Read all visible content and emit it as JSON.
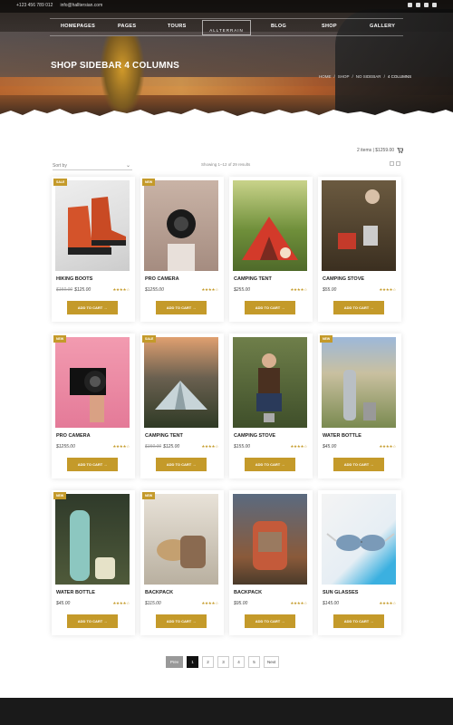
{
  "topbar": {
    "phone": "+123 456 789 012",
    "email": "info@halltersian.com"
  },
  "nav": {
    "items": [
      "HOMEPAGES",
      "PAGES",
      "TOURS",
      "BLOG",
      "SHOP",
      "GALLERY"
    ],
    "logo": "ALLTERRAIN"
  },
  "hero": {
    "title": "SHOP SIDEBAR 4 COLUMNS",
    "breadcrumb": [
      "HOME",
      "/",
      "SHOP",
      "/",
      "NO SIDEBAR",
      "/",
      "4 COLUMNS"
    ]
  },
  "toolbar": {
    "cart": "2 items | $1259.00",
    "sort": "Sort by",
    "results": "Showing 1–12 of 29 results"
  },
  "products": [
    {
      "badge": "SALE",
      "title": "HIKING BOOTS",
      "old_price": "$150.00",
      "price": "$125.00",
      "stars": "★★★★☆",
      "button": "ADD TO CART →"
    },
    {
      "badge": "NEW",
      "title": "PRO CAMERA",
      "old_price": "",
      "price": "$1255.00",
      "stars": "★★★★☆",
      "button": "ADD TO CART →"
    },
    {
      "badge": "",
      "title": "CAMPING TENT",
      "old_price": "",
      "price": "$255.00",
      "stars": "★★★★☆",
      "button": "ADD TO CART →"
    },
    {
      "badge": "",
      "title": "CAMPING STOVE",
      "old_price": "",
      "price": "$55.00",
      "stars": "★★★★☆",
      "button": "ADD TO CART →"
    },
    {
      "badge": "NEW",
      "title": "PRO CAMERA",
      "old_price": "",
      "price": "$1255.00",
      "stars": "★★★★☆",
      "button": "ADD TO CART →"
    },
    {
      "badge": "SALE",
      "title": "CAMPING TENT",
      "old_price": "$150.00",
      "price": "$125.00",
      "stars": "★★★★☆",
      "button": "ADD TO CART →"
    },
    {
      "badge": "",
      "title": "CAMPING STOVE",
      "old_price": "",
      "price": "$155.00",
      "stars": "★★★★☆",
      "button": "ADD TO CART →"
    },
    {
      "badge": "NEW",
      "title": "WATER BOTTLE",
      "old_price": "",
      "price": "$45.00",
      "stars": "★★★★☆",
      "button": "ADD TO CART →"
    },
    {
      "badge": "NEW",
      "title": "WATER BOTTLE",
      "old_price": "",
      "price": "$45.00",
      "stars": "★★★★☆",
      "button": "ADD TO CART →"
    },
    {
      "badge": "NEW",
      "title": "BACKPACK",
      "old_price": "",
      "price": "$115.00",
      "stars": "★★★★☆",
      "button": "ADD TO CART →"
    },
    {
      "badge": "",
      "title": "BACKPACK",
      "old_price": "",
      "price": "$95.00",
      "stars": "★★★★☆",
      "button": "ADD TO CART →"
    },
    {
      "badge": "",
      "title": "SUN GLASSES",
      "old_price": "",
      "price": "$145.00",
      "stars": "★★★★☆",
      "button": "ADD TO CART →"
    }
  ],
  "pagination": {
    "prev": "Prev",
    "pages": [
      "1",
      "2",
      "3",
      "4",
      "5"
    ],
    "next": "Next"
  },
  "colors": {
    "accent": "#c49a2a",
    "dark": "#1a1a1a"
  },
  "icons": {
    "cart": "cart-icon",
    "grid": "grid-view-icon",
    "list": "list-view-icon"
  }
}
